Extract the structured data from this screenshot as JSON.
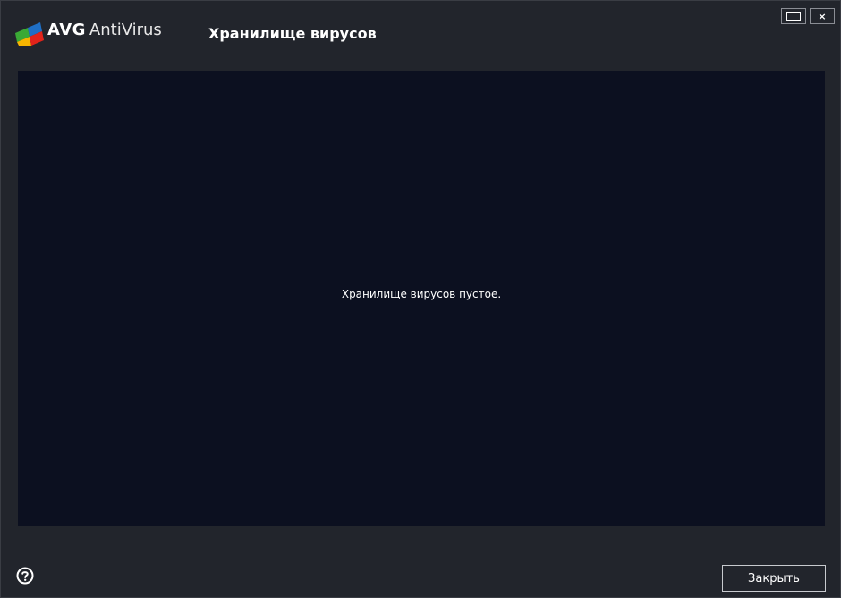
{
  "window": {
    "brand_avg": "AVG",
    "brand_product": "AntiVirus",
    "title": "Хранилище вирусов",
    "controls": {
      "maximize_icon": "maximize-icon",
      "close_icon": "close-icon",
      "close_glyph": "×"
    }
  },
  "content": {
    "empty_message": "Хранилище вирусов пустое."
  },
  "footer": {
    "help_icon": "help-icon",
    "close_button_label": "Закрыть"
  },
  "colors": {
    "window_background": "#22252c",
    "content_background": "#0c1020",
    "text": "#ffffff",
    "logo_red": "#e2231a",
    "logo_yellow": "#f7b500",
    "logo_green": "#3aa935",
    "logo_blue": "#1f6fc5"
  }
}
